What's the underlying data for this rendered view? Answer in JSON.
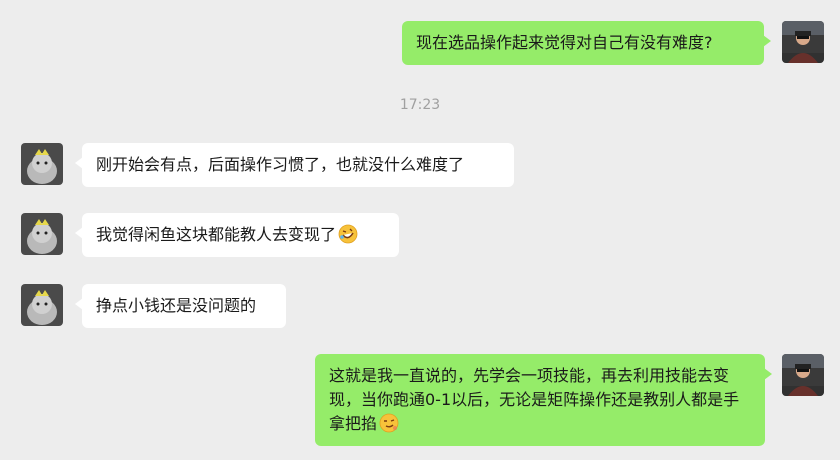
{
  "messages": [
    {
      "side": "right",
      "text": "现在选品操作起来觉得对自己有没有难度?"
    },
    {
      "side": "left",
      "text": "刚开始会有点，后面操作习惯了，也就没什么难度了"
    },
    {
      "side": "left",
      "text": "我觉得闲鱼这块都能教人去变现了",
      "emoji": "rofl-emoji"
    },
    {
      "side": "left",
      "text": "挣点小钱还是没问题的"
    },
    {
      "side": "right",
      "text": "这就是我一直说的，先学会一项技能，再去利用技能去变现，当你跑通0-1以后，无论是矩阵操作还是教别人都是手拿把掐",
      "emoji": "smirk-emoji"
    }
  ],
  "timestamp": "17:23",
  "colors": {
    "background": "#ededed",
    "self_bubble": "#95ec69",
    "other_bubble": "#ffffff"
  }
}
